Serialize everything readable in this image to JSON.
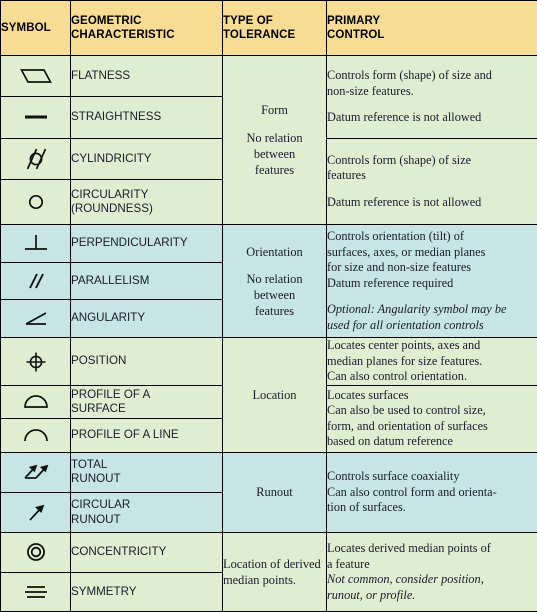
{
  "table": {
    "headers": [
      {
        "label": "SYMBOL",
        "name": "header-symbol"
      },
      {
        "label": "GEOMETRIC CHARACTERISTIC",
        "name": "header-geometric-characteristic"
      },
      {
        "label": "TYPE OF TOLERANCE",
        "name": "header-type-of-tolerance"
      },
      {
        "label": "PRIMARY CONTROL",
        "name": "header-primary-control"
      }
    ],
    "header_lines": {
      "symbol": "SYMBOL",
      "geometric_l1": "GEOMETRIC",
      "geometric_l2": "CHARACTERISTIC",
      "type_l1": "TYPE OF",
      "type_l2": "TOLERANCE",
      "primary_l1": "PRIMARY",
      "primary_l2": "CONTROL"
    },
    "rows": [
      {
        "symbol_icon": "flatness-parallelogram-icon",
        "characteristic": "FLATNESS"
      },
      {
        "symbol_icon": "straightness-line-icon",
        "characteristic": "STRAIGHTNESS"
      },
      {
        "symbol_icon": "cylindricity-icon",
        "characteristic": "CYLINDRICITY"
      },
      {
        "symbol_icon": "circularity-circle-icon",
        "characteristic_l1": "CIRCULARITY",
        "characteristic_l2": "(ROUNDNESS)"
      },
      {
        "symbol_icon": "perpendicularity-icon",
        "characteristic": "PERPENDICULARITY"
      },
      {
        "symbol_icon": "parallelism-icon",
        "characteristic": "PARALLELISM"
      },
      {
        "symbol_icon": "angularity-icon",
        "characteristic": "ANGULARITY"
      },
      {
        "symbol_icon": "position-crosshair-icon",
        "characteristic": "POSITION"
      },
      {
        "symbol_icon": "profile-of-surface-icon",
        "characteristic_l1": "PROFILE OF A",
        "characteristic_l2": "SURFACE"
      },
      {
        "symbol_icon": "profile-of-line-icon",
        "characteristic": "PROFILE OF A LINE"
      },
      {
        "symbol_icon": "total-runout-icon",
        "characteristic_l1": "TOTAL",
        "characteristic_l2": "RUNOUT"
      },
      {
        "symbol_icon": "circular-runout-icon",
        "characteristic_l1": "CIRCULAR",
        "characteristic_l2": "RUNOUT"
      },
      {
        "symbol_icon": "concentricity-icon",
        "characteristic": "CONCENTRICITY"
      },
      {
        "symbol_icon": "symmetry-icon",
        "characteristic": "SYMMETRY"
      }
    ],
    "tolerance_types": {
      "form": {
        "title": "Form",
        "sub_l1": "No relation",
        "sub_l2": "between",
        "sub_l3": "features"
      },
      "orientation": {
        "title": "Orientation",
        "sub_l1": "No relation",
        "sub_l2": "between",
        "sub_l3": "features"
      },
      "location": {
        "title": "Location"
      },
      "runout": {
        "title": "Runout"
      },
      "location_derived": {
        "l1": "Location of",
        "l2": "derived median",
        "l3": "points."
      }
    },
    "controls": {
      "form_flat_straight": {
        "l1": "Controls form (shape) of size and",
        "l2": "non-size features.",
        "l3": "Datum reference is not allowed"
      },
      "form_cyl_circ": {
        "l1": "Controls form (shape) of size",
        "l2": "features",
        "l3": "Datum reference is not allowed"
      },
      "orientation": {
        "l1": "Controls orientation (tilt) of",
        "l2": "surfaces, axes, or median planes",
        "l3": "for size and non-size features",
        "l4": "Datum reference required",
        "italic_l1": "Optional: Angularity symbol may be",
        "italic_l2": "used for all orientation controls"
      },
      "position": {
        "l1": "Locates center points, axes and",
        "l2": "median planes for size features.",
        "l3": "Can also control orientation."
      },
      "profile": {
        "l1": "Locates surfaces",
        "l2": "Can also be used to control size,",
        "l3": "form, and orientation of surfaces",
        "l4": "based on datum reference"
      },
      "runout": {
        "l1": "Controls surface coaxiality",
        "l2": "Can also control form and orienta-",
        "l3": "tion of surfaces."
      },
      "concentricity_symmetry": {
        "l1": "Locates derived median points of",
        "l2": "a feature",
        "italic_l1": "Not common, consider position,",
        "italic_l2": "runout, or profile."
      }
    },
    "colors": {
      "header_bg": "#f7dd94",
      "green_bg": "#dfeed0",
      "blue_bg": "#c7e5e5",
      "border": "#000000",
      "text": "#1a1a2e"
    }
  }
}
